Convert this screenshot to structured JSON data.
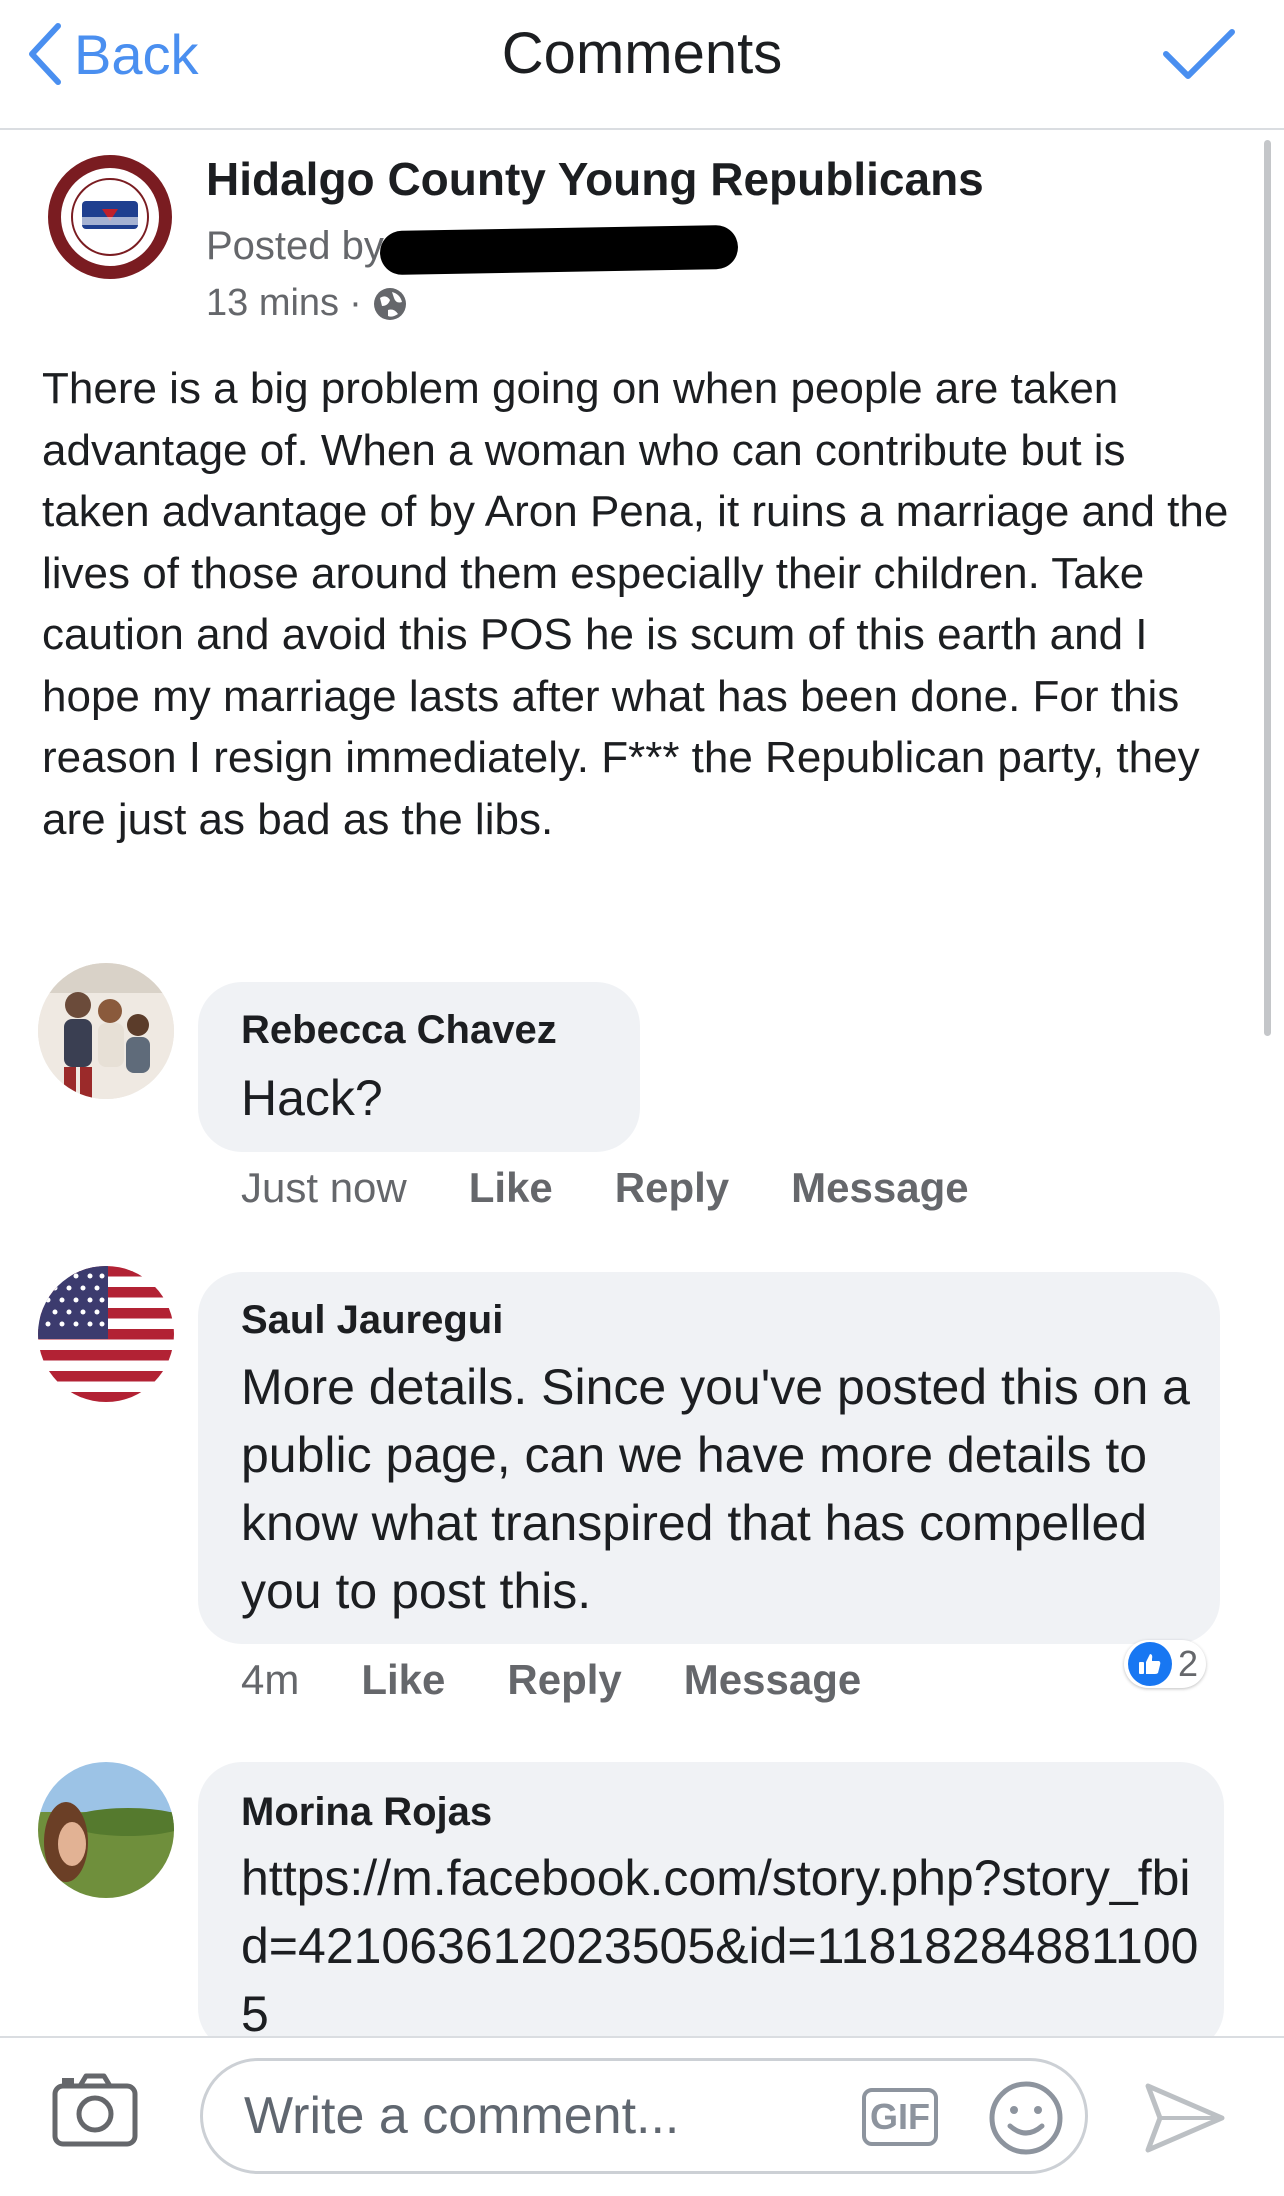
{
  "nav": {
    "back_label": "Back",
    "title": "Comments",
    "done_icon": "checkmark-icon"
  },
  "post": {
    "page_name": "Hidalgo County Young Republicans",
    "posted_by_label": "Posted by",
    "time": "13 mins",
    "separator": "·",
    "privacy_icon": "globe-icon",
    "body": "There is a big problem going on when people are taken advantage of. When a woman who can contribute but is taken advantage of by Aron Pena, it ruins a marriage and the lives of those around them especially their children. Take caution and avoid this POS he is scum of this earth and I hope my marriage lasts after what has been done. For this reason I resign immediately. F*** the Republican party, they are just as bad as the libs."
  },
  "comments": [
    {
      "name": "Rebecca Chavez",
      "text": "Hack?",
      "time": "Just now",
      "like": "Like",
      "reply": "Reply",
      "message": "Message"
    },
    {
      "name": "Saul Jauregui",
      "text": "More details. Since you've posted this on a public page, can we have more details to know what transpired that has compelled you to post this.",
      "time": "4m",
      "like": "Like",
      "reply": "Reply",
      "message": "Message",
      "reaction_count": "2"
    },
    {
      "name": "Morina Rojas",
      "text": "https://m.facebook.com/story.php?story_fbid=421063612023505&id=118182848811005"
    }
  ],
  "composer": {
    "placeholder": "Write a comment...",
    "gif_label": "GIF"
  },
  "colors": {
    "accent": "#4a8ff0",
    "like_blue": "#1877f2",
    "bubble": "#f0f2f5",
    "secondary_text": "#65676b"
  }
}
